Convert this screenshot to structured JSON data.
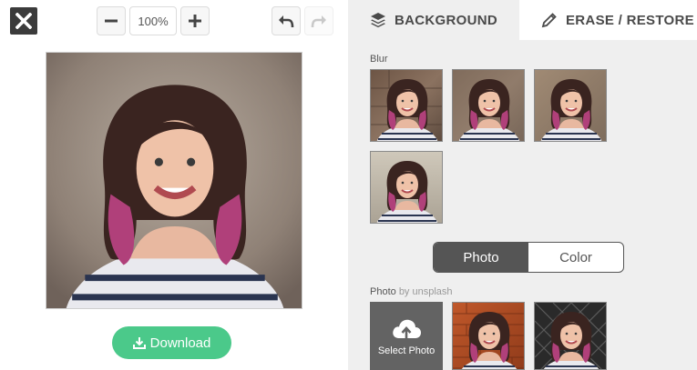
{
  "toolbar": {
    "close_icon": "close-x-icon",
    "zoom_out_icon": "minus-icon",
    "zoom_value": "100%",
    "zoom_in_icon": "plus-icon",
    "undo_icon": "undo-arrow-icon",
    "redo_icon": "redo-arrow-icon"
  },
  "download": {
    "label": "Download",
    "icon": "download-icon"
  },
  "tabs": [
    {
      "label": "BACKGROUND",
      "icon": "layers-icon",
      "active": true
    },
    {
      "label": "ERASE / RESTORE",
      "icon": "pencil-icon",
      "active": false
    }
  ],
  "blur_section": {
    "label": "Blur",
    "thumbnails": [
      "blur-brick-wall",
      "blur-brick-wall-soft",
      "blur-warm",
      "blur-light"
    ]
  },
  "mode_toggle": {
    "photo_label": "Photo",
    "color_label": "Color",
    "selected": "Photo"
  },
  "photo_section": {
    "label": "Photo",
    "credit": "by unsplash",
    "select_label": "Select Photo",
    "select_icon": "cloud-upload-icon",
    "thumbnails": [
      "photo-orange-brick",
      "photo-dark-lattice"
    ]
  },
  "colors": {
    "download_green": "#4bc98a",
    "panel_bg": "#efefef",
    "toggle_active": "#555555",
    "hair_magenta": "#b0407a"
  }
}
